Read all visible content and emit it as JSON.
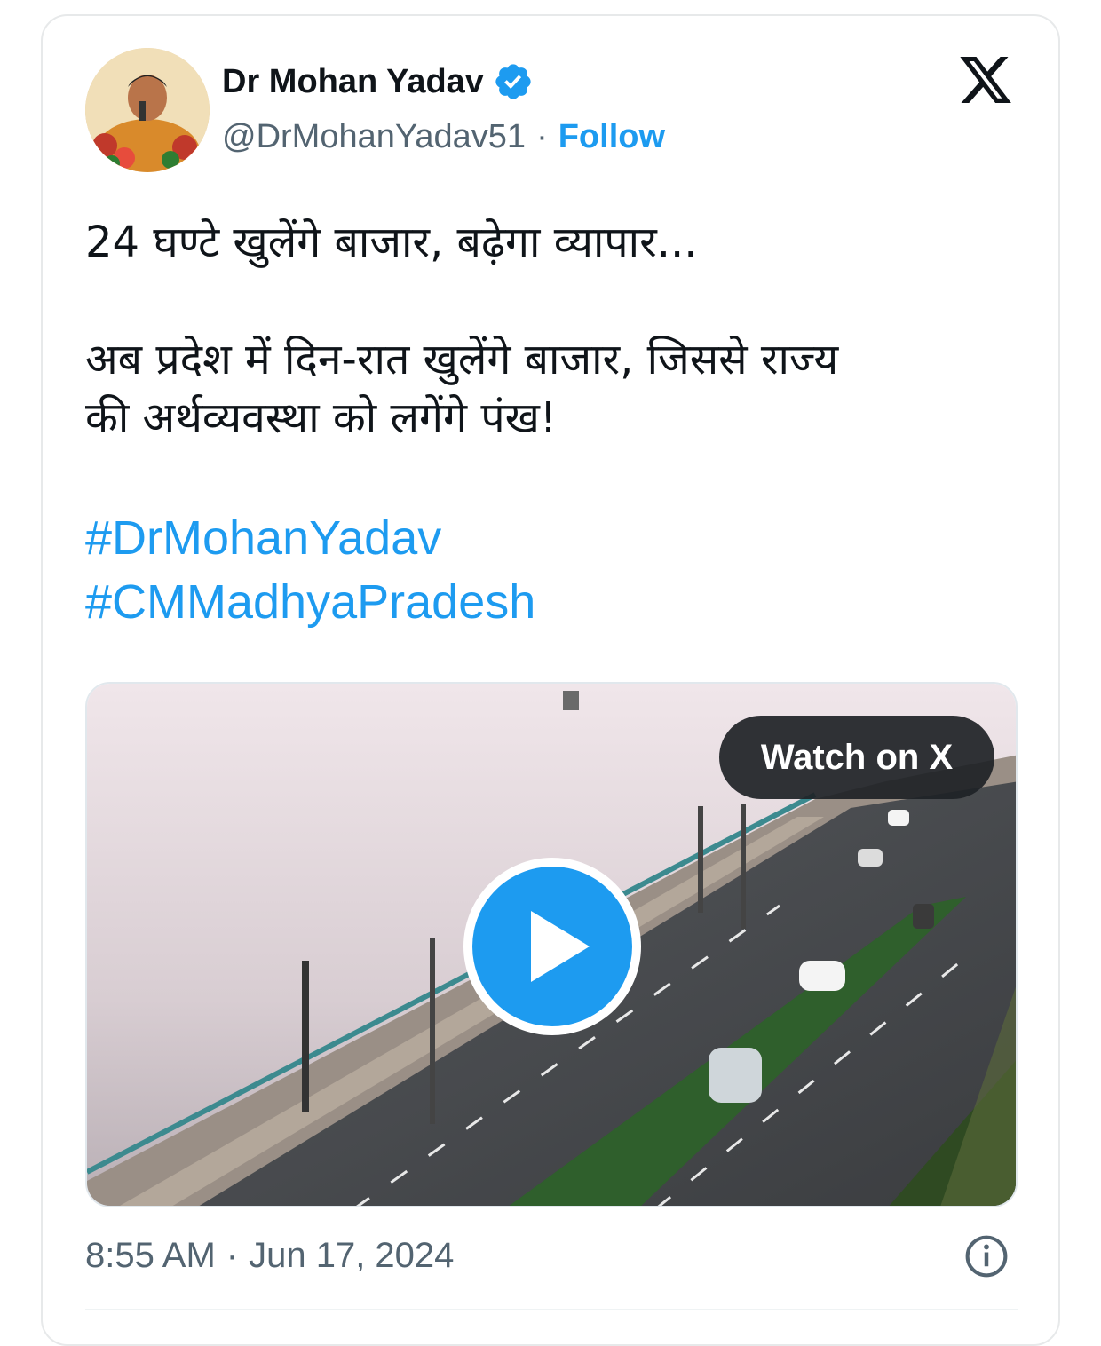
{
  "author": {
    "name": "Dr Mohan Yadav",
    "handle": "@DrMohanYadav51",
    "separator": "·",
    "follow_label": "Follow"
  },
  "icons": {
    "verified": "verified-badge-icon",
    "platform_logo": "x-logo-icon",
    "play": "play-icon",
    "info": "info-icon"
  },
  "tweet": {
    "line1": "24 घण्टे खुलेंगे बाजार, बढ़ेगा व्यापार...",
    "line2": "अब प्रदेश में दिन-रात खुलेंगे बाजार, जिससे राज्य",
    "line3": "की अर्थव्यवस्था को लगेंगे पंख!",
    "hashtags": [
      "#DrMohanYadav",
      "#CMMadhyaPradesh"
    ]
  },
  "media": {
    "watch_label": "Watch on X"
  },
  "meta": {
    "time": "8:55 AM",
    "separator": "·",
    "date": "Jun 17, 2024"
  },
  "colors": {
    "accent": "#1d9bf0",
    "text": "#0f1419",
    "secondary": "#536471"
  }
}
